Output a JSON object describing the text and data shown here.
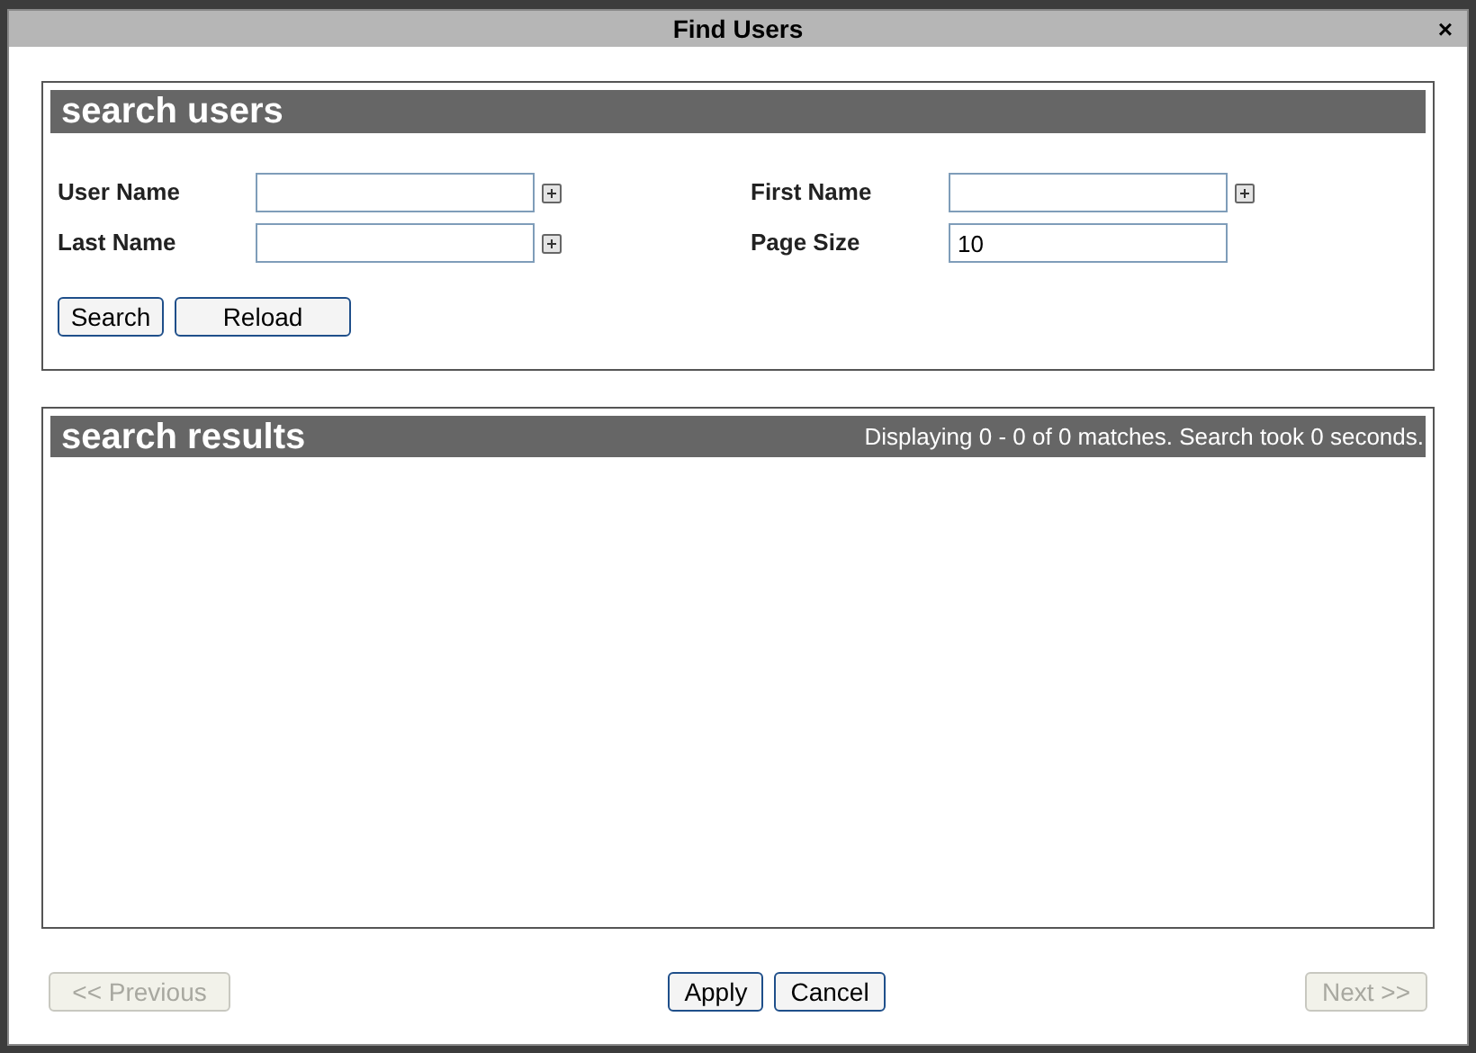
{
  "window": {
    "title": "Find Users",
    "close": "×"
  },
  "search_panel": {
    "title": "search users",
    "fields": [
      {
        "label": "User Name",
        "expandable": true
      },
      {
        "label": "First Name",
        "expandable": true
      },
      {
        "label": "Last Name",
        "expandable": true
      },
      {
        "label": "Page Size",
        "value": "10",
        "expandable": false
      }
    ],
    "buttons": [
      "Search",
      "Reload"
    ]
  },
  "results_panel": {
    "title": "search results",
    "status": "Displaying 0 - 0 of 0 matches. Search took 0 seconds."
  },
  "footer": [
    {
      "label": "<< Previous",
      "disabled": true
    },
    {
      "label": "Apply",
      "disabled": false
    },
    {
      "label": "Cancel",
      "disabled": false
    },
    {
      "label": "Next >>",
      "disabled": true
    }
  ]
}
